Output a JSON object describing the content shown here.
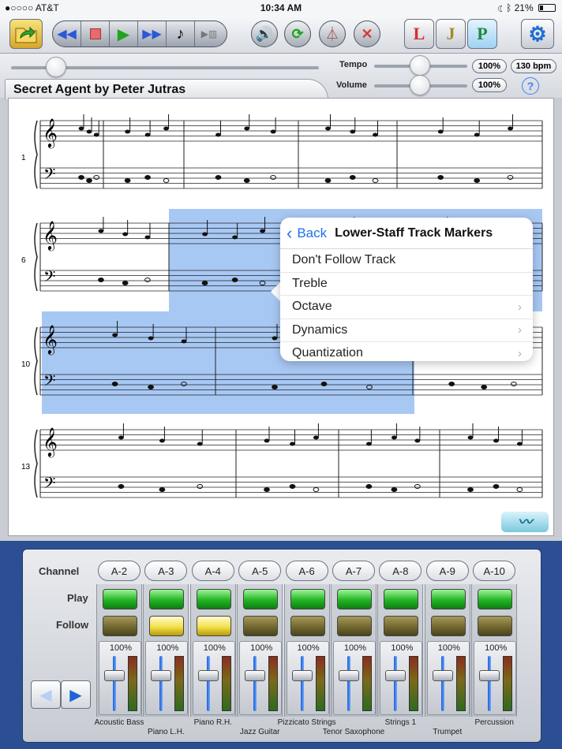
{
  "status": {
    "carrier": "●○○○○ AT&T",
    "time": "10:34 AM",
    "battery": "21%"
  },
  "toolbar": {
    "ljp": [
      "L",
      "J",
      "P"
    ]
  },
  "controls": {
    "tempo_label": "Tempo",
    "volume_label": "Volume",
    "tempo_pct": "100%",
    "tempo_bpm": "130 bpm",
    "volume_pct": "100%",
    "help": "?"
  },
  "score": {
    "title": "Secret Agent by Peter Jutras",
    "measure_numbers": [
      "1",
      "6",
      "10",
      "13"
    ]
  },
  "popover": {
    "back": "Back",
    "title": "Lower-Staff Track Markers",
    "items": [
      {
        "label": "Don't Follow Track",
        "submenu": false
      },
      {
        "label": "Treble",
        "submenu": false
      },
      {
        "label": "Octave",
        "submenu": true
      },
      {
        "label": "Dynamics",
        "submenu": true
      },
      {
        "label": "Quantization",
        "submenu": true
      }
    ]
  },
  "mixer": {
    "channel_label": "Channel",
    "play_label": "Play",
    "follow_label": "Follow",
    "channels": [
      {
        "name": "A-2",
        "follow": "off",
        "volume": "100%",
        "instrument": "Acoustic Bass"
      },
      {
        "name": "A-3",
        "follow": "on",
        "volume": "100%",
        "instrument": "Piano L.H."
      },
      {
        "name": "A-4",
        "follow": "on",
        "volume": "100%",
        "instrument": "Piano R.H."
      },
      {
        "name": "A-5",
        "follow": "off",
        "volume": "100%",
        "instrument": "Jazz Guitar"
      },
      {
        "name": "A-6",
        "follow": "off",
        "volume": "100%",
        "instrument": "Pizzicato Strings"
      },
      {
        "name": "A-7",
        "follow": "off",
        "volume": "100%",
        "instrument": "Tenor Saxophone"
      },
      {
        "name": "A-8",
        "follow": "off",
        "volume": "100%",
        "instrument": "Strings 1"
      },
      {
        "name": "A-9",
        "follow": "off",
        "volume": "100%",
        "instrument": "Trumpet"
      },
      {
        "name": "A-10",
        "follow": "off",
        "volume": "100%",
        "instrument": "Percussion"
      }
    ]
  },
  "colors": {
    "selection": "#609beb",
    "mixer_bg": "#2b4f92",
    "accent": "#1a73e8"
  }
}
